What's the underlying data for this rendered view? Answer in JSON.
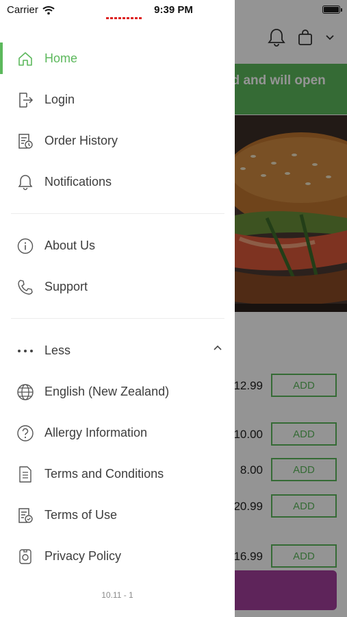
{
  "status_bar": {
    "carrier": "Carrier",
    "time": "9:39 PM"
  },
  "background": {
    "banner_text": "ed and will open",
    "prices": [
      "12.99",
      "10.00",
      "8.00",
      "20.99",
      "16.99"
    ],
    "add_label": "ADD"
  },
  "menu": {
    "primary": [
      {
        "label": "Home",
        "icon": "home-icon",
        "active": true
      },
      {
        "label": "Login",
        "icon": "login-icon"
      },
      {
        "label": "Order History",
        "icon": "order-history-icon"
      },
      {
        "label": "Notifications",
        "icon": "bell-icon"
      }
    ],
    "secondary": [
      {
        "label": "About Us",
        "icon": "info-icon"
      },
      {
        "label": "Support",
        "icon": "phone-icon"
      }
    ],
    "more_toggle": {
      "label": "Less",
      "icon": "more-dots-icon"
    },
    "tertiary": [
      {
        "label": "English (New Zealand)",
        "icon": "globe-icon"
      },
      {
        "label": "Allergy Information",
        "icon": "question-icon"
      },
      {
        "label": "Terms and Conditions",
        "icon": "document-icon"
      },
      {
        "label": "Terms of Use",
        "icon": "document-check-icon"
      },
      {
        "label": "Privacy Policy",
        "icon": "privacy-icon"
      }
    ]
  },
  "version": "10.11 - 1",
  "colors": {
    "accent": "#5cb85c",
    "cart": "#a23e9b"
  }
}
